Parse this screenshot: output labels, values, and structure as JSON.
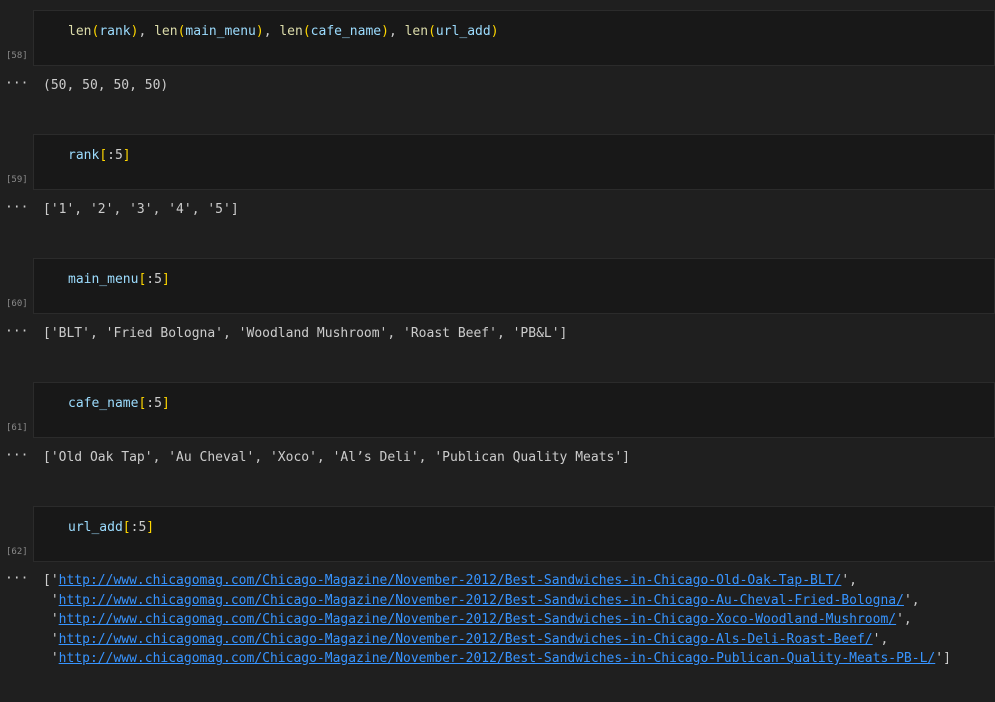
{
  "cells": [
    {
      "count": "[58]",
      "code": {
        "fn1": "len",
        "v1": "rank",
        "fn2": "len",
        "v2": "main_menu",
        "fn3": "len",
        "v3": "cafe_name",
        "fn4": "len",
        "v4": "url_add"
      },
      "output": "(50, 50, 50, 50)"
    },
    {
      "count": "[59]",
      "code": {
        "var": "rank",
        "slice": ":5"
      },
      "output": "['1', '2', '3', '4', '5']"
    },
    {
      "count": "[60]",
      "code": {
        "var": "main_menu",
        "slice": ":5"
      },
      "output": "['BLT', 'Fried Bologna', 'Woodland Mushroom', 'Roast Beef', 'PB&L']"
    },
    {
      "count": "[61]",
      "code": {
        "var": "cafe_name",
        "slice": ":5"
      },
      "output": "['Old Oak Tap', 'Au Cheval', 'Xoco', 'Al’s Deli', 'Publican Quality Meats']"
    },
    {
      "count": "[62]",
      "code": {
        "var": "url_add",
        "slice": ":5"
      },
      "urls": [
        "http://www.chicagomag.com/Chicago-Magazine/November-2012/Best-Sandwiches-in-Chicago-Old-Oak-Tap-BLT/",
        "http://www.chicagomag.com/Chicago-Magazine/November-2012/Best-Sandwiches-in-Chicago-Au-Cheval-Fried-Bologna/",
        "http://www.chicagomag.com/Chicago-Magazine/November-2012/Best-Sandwiches-in-Chicago-Xoco-Woodland-Mushroom/",
        "http://www.chicagomag.com/Chicago-Magazine/November-2012/Best-Sandwiches-in-Chicago-Als-Deli-Roast-Beef/",
        "http://www.chicagomag.com/Chicago-Magazine/November-2012/Best-Sandwiches-in-Chicago-Publican-Quality-Meats-PB-L/"
      ]
    }
  ],
  "output_menu_glyph": "···",
  "colors": {
    "background": "#1f1f1f",
    "cell_background": "#181818",
    "function": "#dcdcaa",
    "variable": "#9cdcfe",
    "bracket": "#ffd700",
    "link": "#3794ff"
  }
}
